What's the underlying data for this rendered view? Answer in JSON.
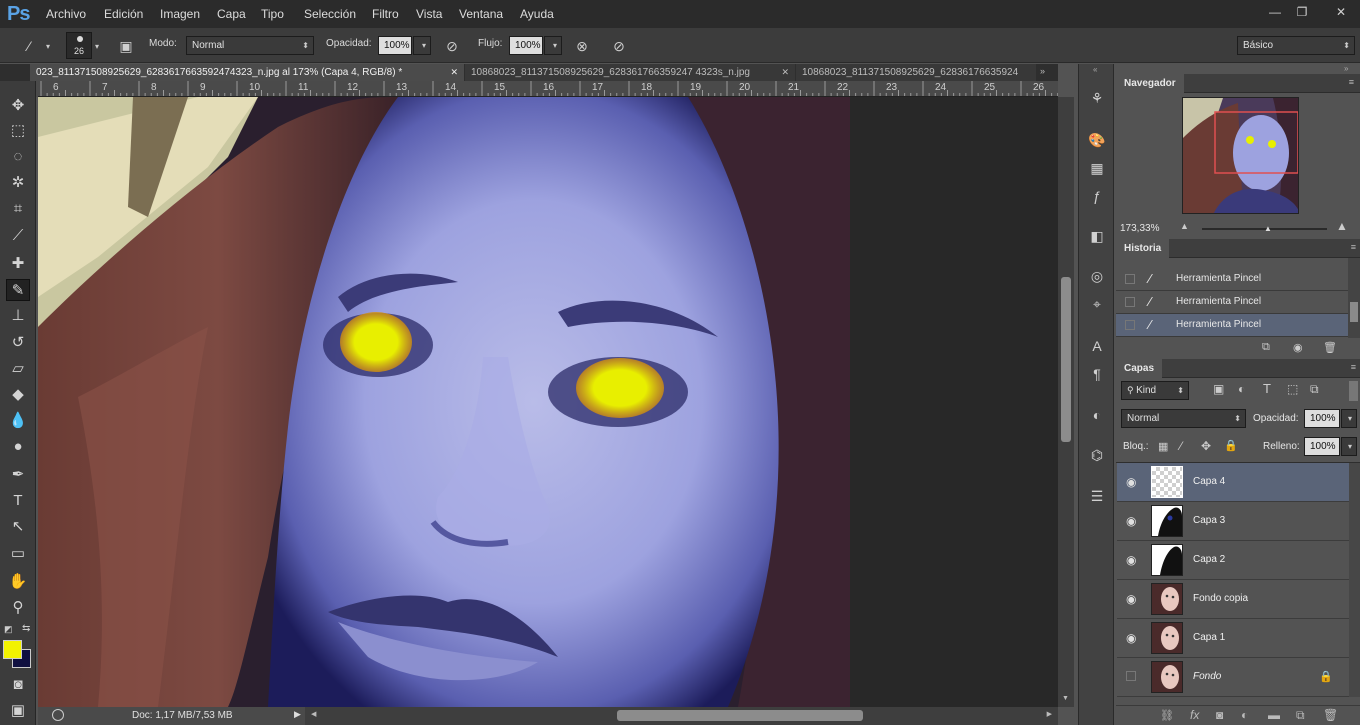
{
  "app": {
    "logo": "Ps"
  },
  "menu": [
    "Archivo",
    "Edición",
    "Imagen",
    "Capa",
    "Tipo",
    "Selección",
    "Filtro",
    "Vista",
    "Ventana",
    "Ayuda"
  ],
  "window_controls": {
    "minimize": "—",
    "restore": "❐",
    "close": "✕"
  },
  "options_bar": {
    "brush_size": "26",
    "mode_label": "Modo:",
    "mode_value": "Normal",
    "opacity_label": "Opacidad:",
    "opacity_value": "100%",
    "flow_label": "Flujo:",
    "flow_value": "100%",
    "workspace": "Básico"
  },
  "tabs": [
    {
      "label": "023_811371508925629_6283617663592474323_n.jpg al 173% (Capa 4, RGB/8) *",
      "close": "✕"
    },
    {
      "label": "10868023_811371508925629_628361766359247 4323s_n.jpg",
      "close": "✕"
    },
    {
      "label": "10868023_811371508925629_62836176635924",
      "close": ""
    }
  ],
  "ruler_numbers": [
    "6",
    "7",
    "8",
    "9",
    "10",
    "11",
    "12",
    "13",
    "14",
    "15",
    "16",
    "17",
    "18",
    "19",
    "20",
    "21",
    "22",
    "23",
    "24",
    "25",
    "26"
  ],
  "status": {
    "doc": "Doc: 1,17 MB/7,53 MB"
  },
  "colors": {
    "foreground": "#f2f200",
    "background": "#101040",
    "accent_selection": "#5a6478"
  },
  "navigator": {
    "title": "Navegador",
    "zoom": "173,33%"
  },
  "history": {
    "title": "Historia",
    "items": [
      {
        "label": "Herramienta Pincel",
        "selected": false
      },
      {
        "label": "Herramienta Pincel",
        "selected": false
      },
      {
        "label": "Herramienta Pincel",
        "selected": true
      }
    ]
  },
  "layers": {
    "title": "Capas",
    "filter_kind": "Kind",
    "blend_mode": "Normal",
    "opacity_label": "Opacidad:",
    "opacity_value": "100%",
    "lock_label": "Bloq.:",
    "fill_label": "Relleno:",
    "fill_value": "100%",
    "items": [
      {
        "name": "Capa 4",
        "visible": true,
        "selected": true,
        "thumb": "transparent"
      },
      {
        "name": "Capa 3",
        "visible": true,
        "selected": false,
        "thumb": "mask-dark"
      },
      {
        "name": "Capa 2",
        "visible": true,
        "selected": false,
        "thumb": "mask-dark"
      },
      {
        "name": "Fondo copia",
        "visible": true,
        "selected": false,
        "thumb": "photo"
      },
      {
        "name": "Capa 1",
        "visible": true,
        "selected": false,
        "thumb": "photo"
      },
      {
        "name": "Fondo",
        "visible": false,
        "selected": false,
        "thumb": "photo",
        "locked": true
      }
    ]
  },
  "icons": {
    "tools": [
      "move-icon",
      "marquee-icon",
      "lasso-icon",
      "magic-wand-icon",
      "crop-icon",
      "eyedropper-icon",
      "healing-icon",
      "brush-icon",
      "stamp-icon",
      "history-brush-icon",
      "eraser-icon",
      "paint-bucket-icon",
      "blur-icon",
      "dodge-icon",
      "pen-icon",
      "type-icon",
      "path-select-icon",
      "rectangle-icon",
      "hand-icon",
      "zoom-icon"
    ]
  }
}
